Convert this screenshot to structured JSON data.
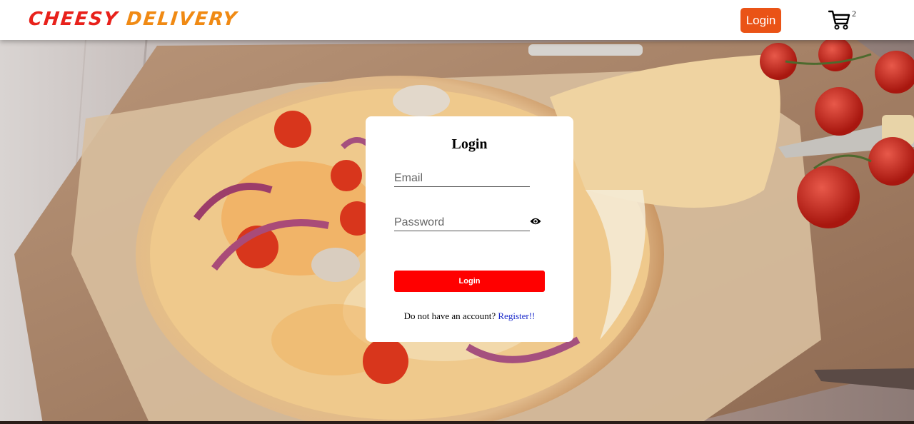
{
  "header": {
    "brand_part1": "CHEESY",
    "brand_part2": "DELIVERY",
    "login_label": "Login",
    "cart_count": "2"
  },
  "login_form": {
    "title": "Login",
    "email_placeholder": "Email",
    "password_placeholder": "Password",
    "submit_label": "Login",
    "register_prompt": "Do not have an account?",
    "register_link": "Register!!"
  },
  "colors": {
    "brand_red": "#e8211b",
    "brand_orange": "#f08a14",
    "header_button": "#ea5316",
    "submit_button": "#ff0000",
    "link": "#1a2acb"
  },
  "icons": [
    "cart-icon",
    "eye-icon"
  ]
}
